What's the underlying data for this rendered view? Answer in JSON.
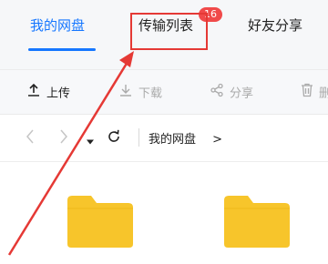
{
  "tabs": [
    {
      "label": "我的网盘",
      "active": true
    },
    {
      "label": "传输列表",
      "active": false,
      "badge": "16"
    },
    {
      "label": "好友分享",
      "active": false
    }
  ],
  "toolbar": {
    "upload": "上传",
    "download": "下载",
    "share": "分享",
    "delete_partial": "删"
  },
  "pathbar": {
    "breadcrumb": "我的网盘",
    "breadcrumb_separator": ">"
  },
  "colors": {
    "accent": "#1677ff",
    "badge": "#f04a4a",
    "annotation": "#e53935",
    "folder": "#f7c52b"
  },
  "folders": [
    {
      "icon": "folder-icon"
    },
    {
      "icon": "folder-icon"
    }
  ]
}
